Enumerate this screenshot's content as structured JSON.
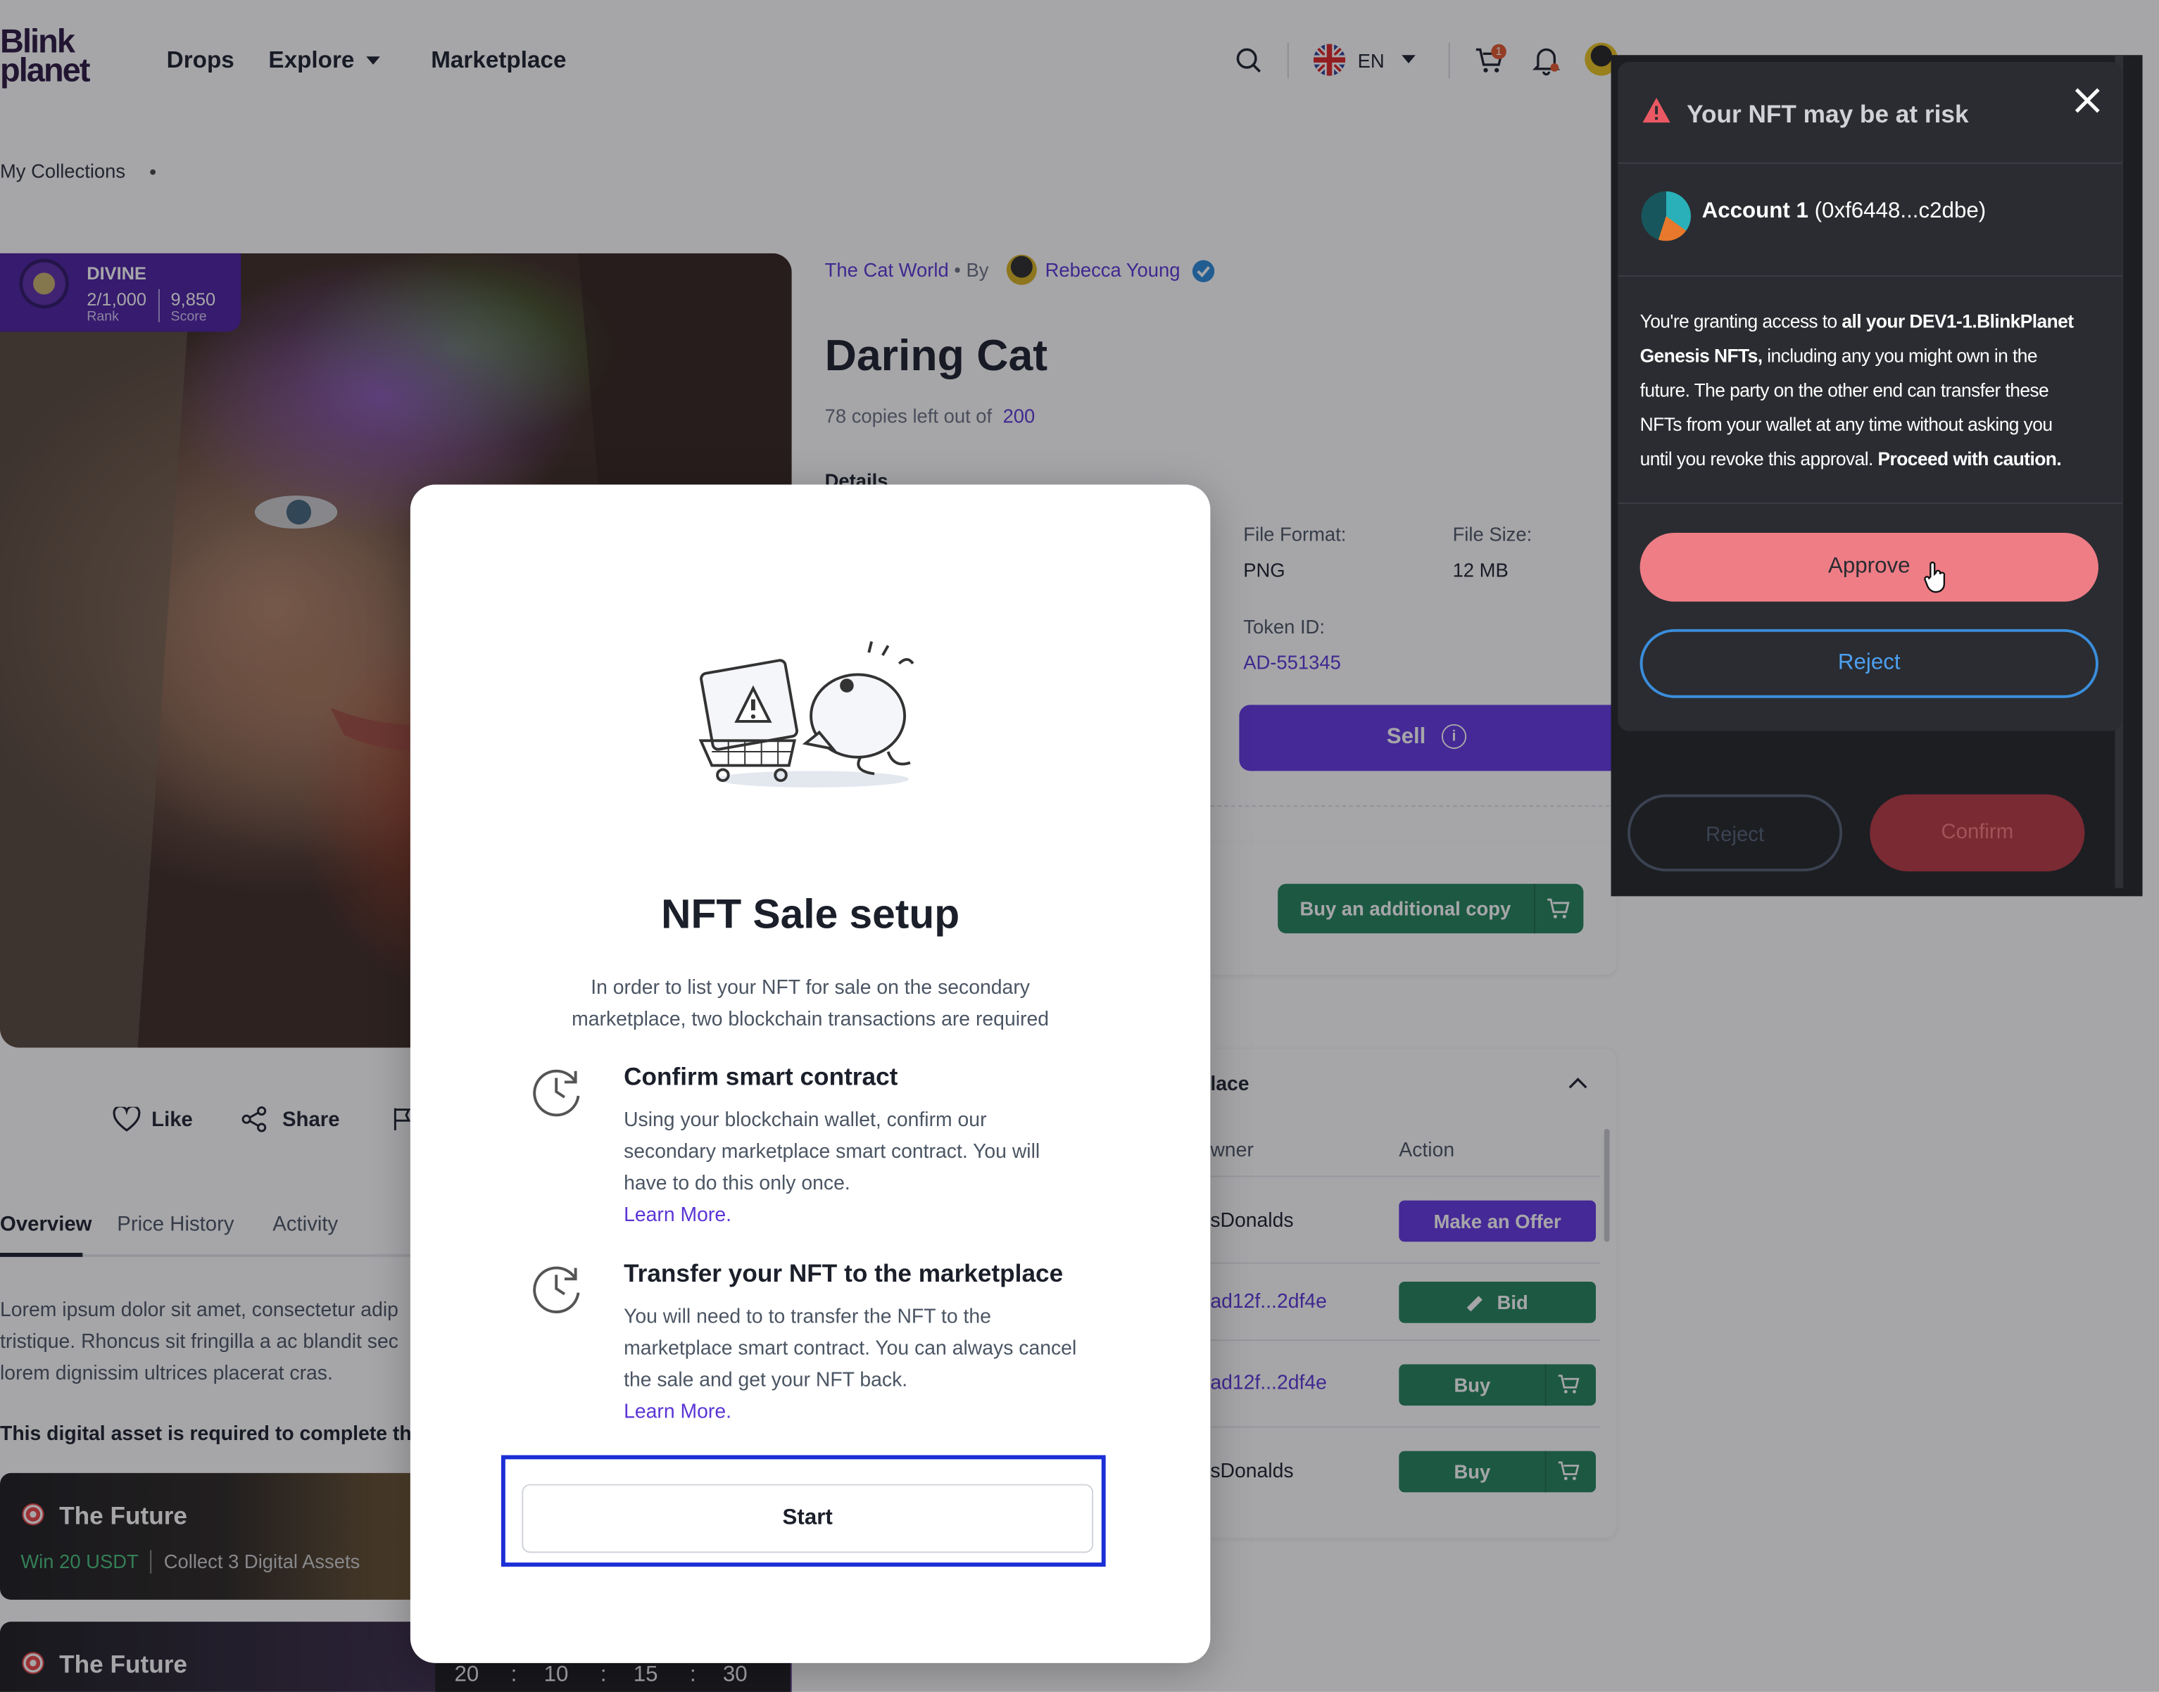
{
  "header": {
    "logo_line1": "Blink",
    "logo_line2": "planet",
    "nav": [
      "Drops",
      "Explore",
      "Marketplace"
    ],
    "language": "EN",
    "cart_count": "1"
  },
  "breadcrumb": {
    "label": "My Collections"
  },
  "asset": {
    "rank_tier": "DIVINE",
    "rank_value": "2/1,000",
    "rank_label": "Rank",
    "score_value": "9,850",
    "score_label": "Score",
    "collection": "The Cat World",
    "by": "By",
    "creator": "Rebecca Young",
    "title": "Daring Cat",
    "copies_text": "78 copies left out of",
    "copies_total": "200",
    "details_heading": "Details",
    "file_format_label": "File Format:",
    "file_format_value": "PNG",
    "file_size_label": "File Size:",
    "file_size_value": "12 MB",
    "token_label": "Token ID:",
    "token_value": "AD-551345",
    "sell_label": "Sell",
    "buy_copy_label": "Buy an additional copy"
  },
  "social": {
    "like": "Like",
    "share": "Share"
  },
  "tabs": [
    "Overview",
    "Price History",
    "Activity"
  ],
  "overview": {
    "line1": "Lorem ipsum dolor sit amet, consectetur adip",
    "line2": "tristique. Rhoncus sit fringilla a ac blandit sec",
    "line3": "lorem dignissim ultrices placerat cras.",
    "required": "This digital asset is required to complete the"
  },
  "quests": [
    {
      "name": "The Future",
      "reward": "Win 20 USDT",
      "task": "Collect 3 Digital Assets"
    },
    {
      "name": "The Future"
    }
  ],
  "countdown": [
    "20",
    "10",
    "15",
    "30"
  ],
  "marketplace": {
    "heading_fragment": "lace",
    "col_owner": "wner",
    "col_action": "Action",
    "rows": [
      {
        "owner": "sDonalds",
        "action": "Make an Offer"
      },
      {
        "owner": "ad12f...2df4e",
        "action": "Bid"
      },
      {
        "owner": "ad12f...2df4e",
        "action": "Buy"
      },
      {
        "owner": "sDonalds",
        "action": "Buy"
      }
    ]
  },
  "modal": {
    "title": "NFT Sale setup",
    "intro_line1": "In order to list your NFT for sale on the secondary",
    "intro_line2": "marketplace, two blockchain transactions are required",
    "step1": {
      "title": "Confirm smart contract",
      "line1": "Using your blockchain wallet, confirm our",
      "line2": "secondary marketplace smart contract. You will",
      "line3": "have to do this only once.",
      "link": "Learn More."
    },
    "step2": {
      "title": "Transfer your NFT to the marketplace",
      "line1": "You will need to to transfer the NFT to the",
      "line2": "marketplace smart contract. You can always cancel",
      "line3": "the sale and get your NFT back.",
      "link": "Learn More."
    },
    "start_label": "Start"
  },
  "wallet": {
    "warning_title": "Your NFT may be at risk",
    "account_name": "Account 1",
    "account_addr": "(0xf6448...c2dbe)",
    "msg1": "You're granting access to ",
    "msg1_bold": "all your DEV1-1.BlinkPlanet",
    "msg2_bold": "Genesis NFTs,",
    "msg2": " including any you might own in the",
    "msg3": "future. The party on the other end can transfer these",
    "msg4": "NFTs from your wallet at any time without asking you",
    "msg5": "until you revoke this approval. ",
    "msg5_bold": "Proceed with caution.",
    "approve": "Approve",
    "reject": "Reject",
    "bg_reject": "Reject",
    "bg_confirm": "Confirm"
  },
  "colors": {
    "primary": "#6336e0",
    "green": "#23845a",
    "accent_pink": "#ef7d86",
    "focus_outline": "#1b2fd6"
  }
}
